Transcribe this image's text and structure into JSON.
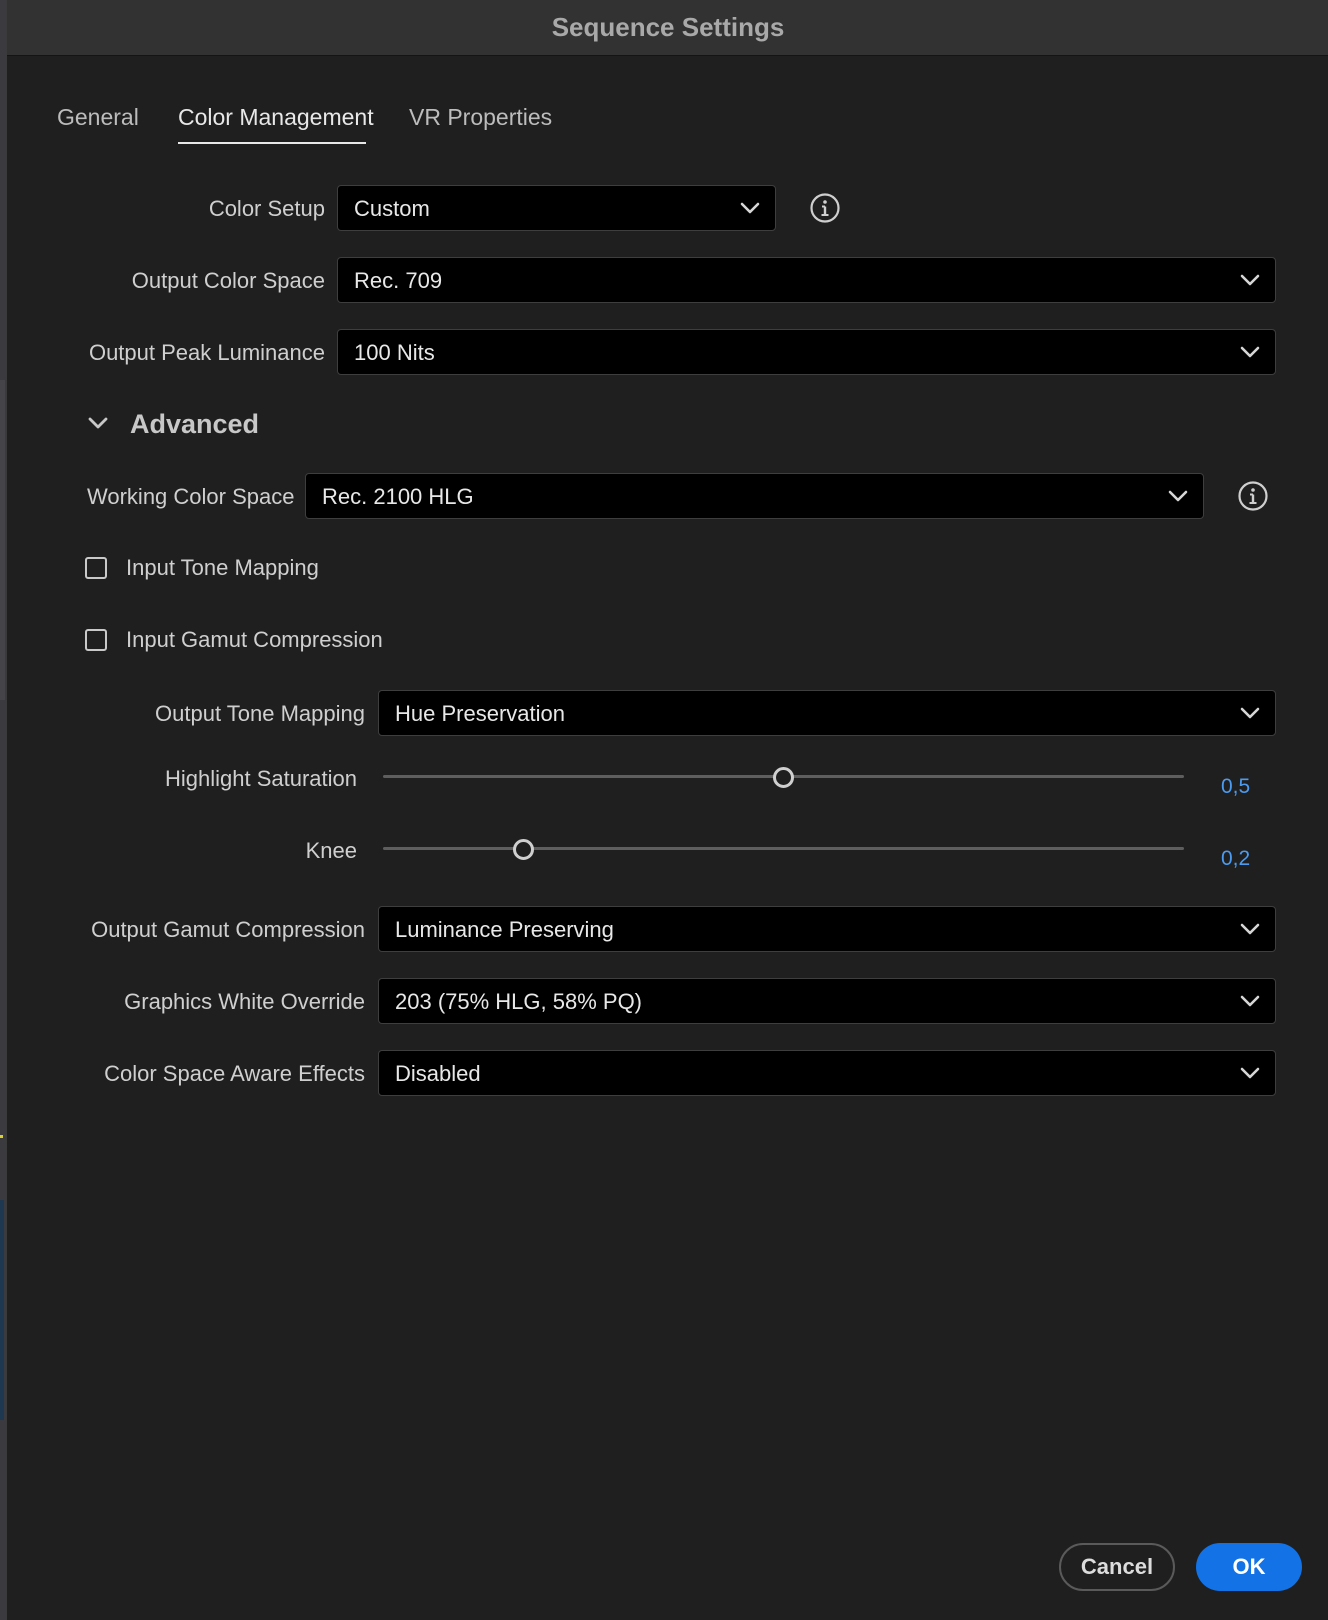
{
  "dialog": {
    "title": "Sequence Settings"
  },
  "tabs": [
    {
      "label": "General",
      "active": false
    },
    {
      "label": "Color Management",
      "active": true
    },
    {
      "label": "VR Properties",
      "active": false
    }
  ],
  "fields": {
    "color_setup": {
      "label": "Color Setup",
      "value": "Custom",
      "icon": "info-icon"
    },
    "output_color_space": {
      "label": "Output Color Space",
      "value": "Rec. 709"
    },
    "output_peak_luminance": {
      "label": "Output Peak Luminance",
      "value": "100 Nits"
    }
  },
  "advanced": {
    "title": "Advanced",
    "expanded": true,
    "working_color_space": {
      "label": "Working Color Space",
      "value": "Rec. 2100 HLG",
      "icon": "info-icon"
    },
    "input_tone_mapping": {
      "label": "Input Tone Mapping",
      "checked": false
    },
    "input_gamut_compression": {
      "label": "Input Gamut Compression",
      "checked": false
    },
    "output_tone_mapping": {
      "label": "Output Tone Mapping",
      "value": "Hue Preservation"
    },
    "highlight_saturation": {
      "label": "Highlight Saturation",
      "value": "0,5",
      "fraction": 0.5
    },
    "knee": {
      "label": "Knee",
      "value": "0,2",
      "fraction": 0.176
    },
    "output_gamut_compression": {
      "label": "Output Gamut Compression",
      "value": "Luminance Preserving"
    },
    "graphics_white_override": {
      "label": "Graphics White Override",
      "value": "203 (75% HLG, 58% PQ)"
    },
    "color_space_aware_effects": {
      "label": "Color Space Aware Effects",
      "value": "Disabled"
    }
  },
  "buttons": {
    "cancel": "Cancel",
    "ok": "OK"
  },
  "colors": {
    "background": "#1f1f1f",
    "titlebar": "#323232",
    "accent": "#1272e6",
    "slider_value": "#4c9bf0"
  }
}
